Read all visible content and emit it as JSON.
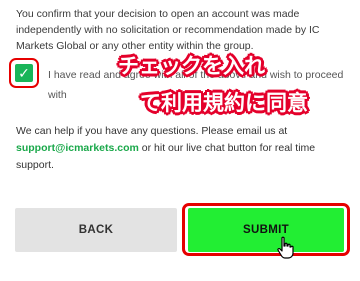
{
  "form": {
    "confirm_text": "You confirm that your decision to open an account was made independently with no solicitation or recommendation made by IC Markets Global or any other entity within the group.",
    "checkbox_checked": true,
    "checkbox_icon": "checkmark-icon",
    "agree_text": "I have read and agree with all of the above and wish to proceed with",
    "help_prefix": "We can help if you have any questions. Please email us at",
    "help_email": "support@icmarkets.com",
    "help_suffix": "or hit our live chat button for real time support.",
    "back_label": "BACK",
    "submit_label": "SUBMIT"
  },
  "annotation": {
    "line1": "チェックを入れ",
    "line2": "て利用規約に同意"
  },
  "colors": {
    "checkbox": "#19b559",
    "email": "#1aa84a",
    "submit_bg": "#22ee33",
    "highlight": "#e60000",
    "back_bg": "#e3e3e3"
  }
}
